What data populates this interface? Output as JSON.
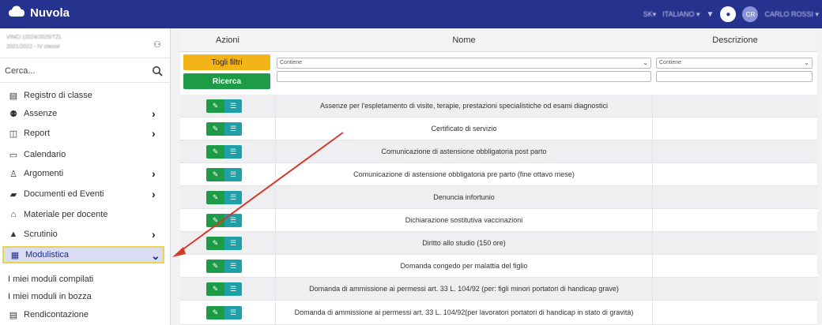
{
  "app": {
    "title": "Nuvola"
  },
  "topbar": {
    "items": [
      "SK▾",
      "ITALIANO ▾",
      "CARLO ROSSI ▾"
    ],
    "avatar_initials": "CR"
  },
  "sidebar": {
    "user_line1": "VINCI (2024/2025/TZL",
    "user_line2": "2021/2022 - IV classe",
    "search_placeholder": "Cerca...",
    "items": [
      {
        "label": "Registro di classe",
        "icon": "book-icon",
        "chevron": ""
      },
      {
        "label": "Assenze",
        "icon": "user-check-icon",
        "chevron": "›"
      },
      {
        "label": "Report",
        "icon": "chart-icon",
        "chevron": "›"
      },
      {
        "label": "Calendario",
        "icon": "calendar-icon",
        "chevron": ""
      },
      {
        "label": "Argomenti",
        "icon": "teacher-icon",
        "chevron": "›"
      },
      {
        "label": "Documenti ed Eventi",
        "icon": "folder-icon",
        "chevron": "›"
      },
      {
        "label": "Materiale per docente",
        "icon": "chalkboard-icon",
        "chevron": ""
      },
      {
        "label": "Scrutinio",
        "icon": "graduation-icon",
        "chevron": "›"
      },
      {
        "label": "Modulistica",
        "icon": "form-icon",
        "chevron": "⌄"
      }
    ],
    "subitems": [
      {
        "label": "I miei moduli compilati"
      },
      {
        "label": "I miei moduli in bozza"
      }
    ],
    "last_item": {
      "label": "Rendicontazione",
      "icon": "clipboard-icon"
    }
  },
  "table": {
    "headers": {
      "actions": "Azioni",
      "name": "Nome",
      "description": "Descrizione"
    },
    "reset_label": "Togli filtri",
    "search_label": "Ricerca",
    "filter_name_select": "Contiene",
    "filter_desc_select": "Contiene",
    "rows": [
      {
        "name": "Assenze per l'espletamento di visite, terapie, prestazioni specialistiche od esami diagnostici"
      },
      {
        "name": "Certificato di servizio"
      },
      {
        "name": "Comunicazione di astensione obbligatoria post parto"
      },
      {
        "name": "Comunicazione di astensione obbligatoria pre parto (fine ottavo mese)"
      },
      {
        "name": "Denuncia infortunio"
      },
      {
        "name": "Dichiarazione sostitutiva vaccinazioni"
      },
      {
        "name": "Diritto allo studio (150 ore)"
      },
      {
        "name": "Domanda congedo per malattia del figlio"
      },
      {
        "name": "Domanda di ammissione ai permessi art. 33 L. 104/92 (per: figli minori portatori di handicap grave)"
      },
      {
        "name": "Domanda di ammissione ai permessi art. 33 L. 104/92(per lavoratori portatori di handicap in stato di gravità)"
      }
    ]
  },
  "colors": {
    "topbar": "#26338e",
    "reset": "#f2b418",
    "search": "#1d9b47",
    "edit": "#1d9b47",
    "list": "#1f9fa8",
    "highlight": "#e5d64a",
    "arrow": "#d23a2c"
  }
}
